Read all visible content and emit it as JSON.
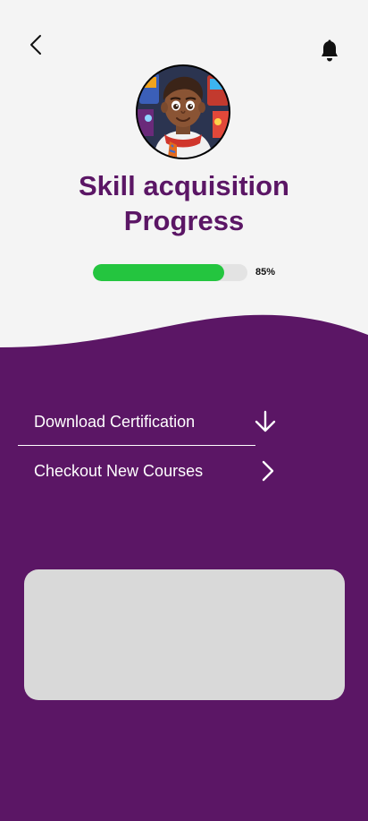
{
  "header": {
    "back_icon": "chevron-left-icon",
    "notification_icon": "bell-icon"
  },
  "profile": {
    "avatar": "avatar-illustration"
  },
  "title": {
    "line1": "Skill acquisition",
    "line2": "Progress"
  },
  "progress": {
    "value": 0.85,
    "label": "85%"
  },
  "menu": {
    "items": [
      {
        "label": "Download Certification",
        "icon": "arrow-down-icon"
      },
      {
        "label": "Checkout New Courses",
        "icon": "chevron-right-icon"
      }
    ]
  },
  "colors": {
    "background": "#f4f4f4",
    "purple": "#5b1665",
    "progress_fill": "#24c53f",
    "progress_track": "#e3e3e3",
    "card": "#d9d9d9",
    "text_white": "#ffffff"
  }
}
